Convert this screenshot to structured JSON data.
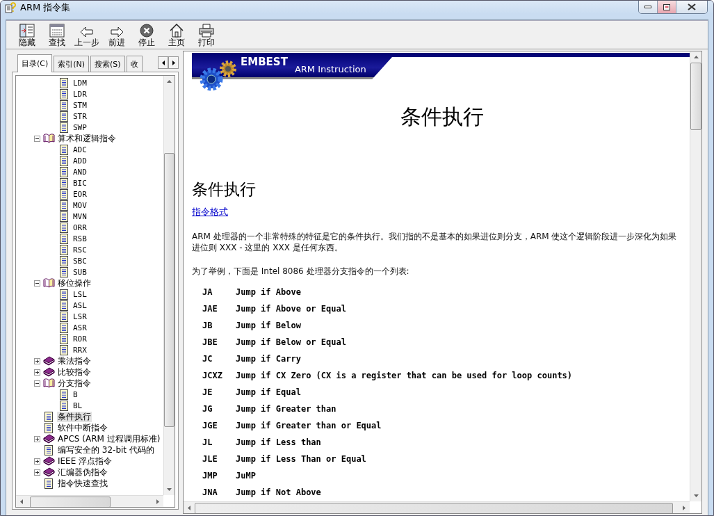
{
  "window": {
    "title": "ARM 指令集"
  },
  "toolbar": [
    {
      "kind": "hide",
      "label": "隐藏"
    },
    {
      "kind": "find",
      "label": "查找"
    },
    {
      "kind": "back",
      "label": "上一步"
    },
    {
      "kind": "forward",
      "label": "前进"
    },
    {
      "kind": "stop",
      "label": "停止"
    },
    {
      "kind": "home",
      "label": "主页"
    },
    {
      "kind": "print",
      "label": "打印"
    }
  ],
  "nav": {
    "tabs": [
      {
        "label": "目录(C)",
        "selected": true
      },
      {
        "label": "索引(N)",
        "selected": false
      },
      {
        "label": "搜索(S)",
        "selected": false
      },
      {
        "label": "收",
        "selected": false
      }
    ],
    "tree": {
      "continued_children": [
        {
          "kind": "doc",
          "label": "LDM",
          "selected": false
        },
        {
          "kind": "doc",
          "label": "LDR",
          "selected": false
        },
        {
          "kind": "doc",
          "label": "STM",
          "selected": false
        },
        {
          "kind": "doc",
          "label": "STR",
          "selected": false
        },
        {
          "kind": "doc",
          "label": "SWP",
          "selected": false
        }
      ],
      "items": [
        {
          "kind": "book",
          "label": "算术和逻辑指令",
          "expanded": true,
          "selected": false,
          "children": [
            {
              "kind": "doc",
              "label": "ADC",
              "selected": false
            },
            {
              "kind": "doc",
              "label": "ADD",
              "selected": false
            },
            {
              "kind": "doc",
              "label": "AND",
              "selected": false
            },
            {
              "kind": "doc",
              "label": "BIC",
              "selected": false
            },
            {
              "kind": "doc",
              "label": "EOR",
              "selected": false
            },
            {
              "kind": "doc",
              "label": "MOV",
              "selected": false
            },
            {
              "kind": "doc",
              "label": "MVN",
              "selected": false
            },
            {
              "kind": "doc",
              "label": "ORR",
              "selected": false
            },
            {
              "kind": "doc",
              "label": "RSB",
              "selected": false
            },
            {
              "kind": "doc",
              "label": "RSC",
              "selected": false
            },
            {
              "kind": "doc",
              "label": "SBC",
              "selected": false
            },
            {
              "kind": "doc",
              "label": "SUB",
              "selected": false
            }
          ]
        },
        {
          "kind": "book",
          "label": "移位操作",
          "expanded": true,
          "selected": false,
          "children": [
            {
              "kind": "doc",
              "label": "LSL",
              "selected": false
            },
            {
              "kind": "doc",
              "label": "ASL",
              "selected": false
            },
            {
              "kind": "doc",
              "label": "LSR",
              "selected": false
            },
            {
              "kind": "doc",
              "label": "ASR",
              "selected": false
            },
            {
              "kind": "doc",
              "label": "ROR",
              "selected": false
            },
            {
              "kind": "doc",
              "label": "RRX",
              "selected": false
            }
          ]
        },
        {
          "kind": "book",
          "label": "乘法指令",
          "expanded": false,
          "selected": false
        },
        {
          "kind": "book",
          "label": "比较指令",
          "expanded": false,
          "selected": false
        },
        {
          "kind": "book",
          "label": "分支指令",
          "expanded": true,
          "selected": false,
          "children": [
            {
              "kind": "doc",
              "label": "B",
              "selected": false
            },
            {
              "kind": "doc",
              "label": "BL",
              "selected": false
            }
          ]
        },
        {
          "kind": "doc",
          "label": "条件执行",
          "selected": true
        },
        {
          "kind": "doc",
          "label": "软件中断指令",
          "selected": false
        },
        {
          "kind": "book",
          "label": "APCS (ARM 过程调用标准)",
          "expanded": false,
          "selected": false
        },
        {
          "kind": "doc",
          "label": "编写安全的 32-bit 代码的",
          "selected": false
        },
        {
          "kind": "book",
          "label": "IEEE 浮点指令",
          "expanded": false,
          "selected": false
        },
        {
          "kind": "book",
          "label": "汇编器伪指令",
          "expanded": false,
          "selected": false
        },
        {
          "kind": "doc",
          "label": "指令快速查找",
          "selected": false
        }
      ]
    }
  },
  "topic": {
    "banner": {
      "brand": "EMBEST",
      "subtitle": "ARM Instruction"
    },
    "title": "条件执行",
    "heading": "条件执行",
    "link": "指令格式",
    "paragraphs": [
      "ARM 处理器的一个非常特殊的特征是它的条件执行。我们指的不是基本的如果进位则分支，ARM 使这个逻辑阶段进一步深化为如果进位则 XXX - 这里的 XXX 是任何东西。",
      "为了举例，下面是 Intel 8086 处理器分支指令的一个列表:"
    ],
    "instructions": [
      {
        "mnemonic": "JA",
        "description": "Jump if Above"
      },
      {
        "mnemonic": "JAE",
        "description": "Jump if Above or Equal"
      },
      {
        "mnemonic": "JB",
        "description": "Jump if Below"
      },
      {
        "mnemonic": "JBE",
        "description": "Jump if Below or Equal"
      },
      {
        "mnemonic": "JC",
        "description": "Jump if Carry"
      },
      {
        "mnemonic": "JCXZ",
        "description": "Jump if CX Zero (CX is a register that can be used for loop counts)"
      },
      {
        "mnemonic": "JE",
        "description": "Jump if Equal"
      },
      {
        "mnemonic": "JG",
        "description": "Jump if Greater than"
      },
      {
        "mnemonic": "JGE",
        "description": "Jump if Greater than or Equal"
      },
      {
        "mnemonic": "JL",
        "description": "Jump if Less than"
      },
      {
        "mnemonic": "JLE",
        "description": "Jump if Less Than or Equal"
      },
      {
        "mnemonic": "JMP",
        "description": "JuMP"
      },
      {
        "mnemonic": "JNA",
        "description": "Jump if Not Above"
      }
    ]
  }
}
